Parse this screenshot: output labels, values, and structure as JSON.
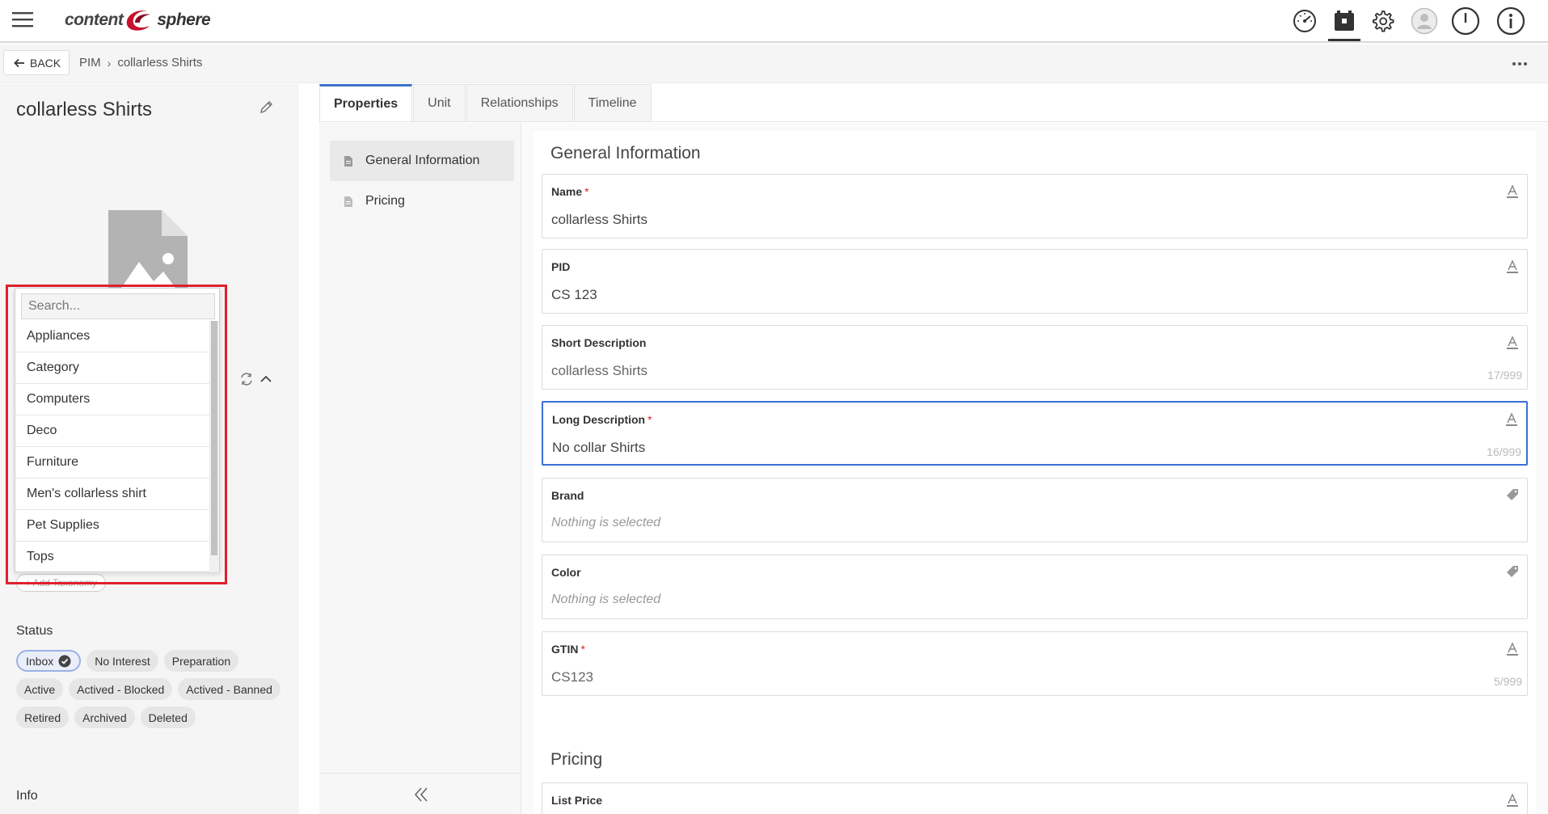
{
  "app": {
    "logo_word1": "content",
    "logo_word2": "sphere"
  },
  "topbar": {
    "icons": [
      "dashboard-gauge-icon",
      "product-catalog-icon",
      "settings-gear-icon",
      "user-avatar-icon",
      "power-icon",
      "info-icon"
    ],
    "active_icon": "product-catalog-icon"
  },
  "breadcrumb": {
    "back_label": "BACK",
    "items": [
      "PIM",
      "collarless Shirts"
    ]
  },
  "entity": {
    "title": "collarless Shirts"
  },
  "taxonomy": {
    "search_placeholder": "Search...",
    "options": [
      "Appliances",
      "Category",
      "Computers",
      "Deco",
      "Furniture",
      "Men's collarless shirt",
      "Pet Supplies",
      "Tops"
    ],
    "add_label": "+ Add Taxonomy"
  },
  "status": {
    "label": "Status",
    "chips": [
      "Inbox",
      "No Interest",
      "Preparation",
      "Active",
      "Actived - Blocked",
      "Actived - Banned",
      "Retired",
      "Archived",
      "Deleted"
    ],
    "selected": "Inbox"
  },
  "info": {
    "label": "Info"
  },
  "tabs": [
    "Properties",
    "Unit",
    "Relationships",
    "Timeline"
  ],
  "active_tab": "Properties",
  "section_nav": [
    "General Information",
    "Pricing"
  ],
  "active_section": "General Information",
  "form": {
    "general_heading": "General Information",
    "fields": [
      {
        "label": "Name",
        "required": true,
        "value": "collarless Shirts",
        "counter": "",
        "icon": "text-field-icon"
      },
      {
        "label": "PID",
        "required": false,
        "value": "CS 123",
        "counter": "",
        "icon": "text-field-icon"
      },
      {
        "label": "Short Description",
        "required": false,
        "value": "collarless Shirts",
        "counter": "17/999",
        "icon": "text-field-icon"
      },
      {
        "label": "Long Description",
        "required": true,
        "value": "No collar Shirts",
        "counter": "16/999",
        "icon": "text-field-icon"
      },
      {
        "label": "Brand",
        "required": false,
        "value": "Nothing is selected",
        "counter": "",
        "icon": "tag-icon"
      },
      {
        "label": "Color",
        "required": false,
        "value": "Nothing is selected",
        "counter": "",
        "icon": "tag-icon"
      },
      {
        "label": "GTIN",
        "required": true,
        "value": "CS123",
        "counter": "5/999",
        "icon": "text-field-icon"
      }
    ],
    "pricing_heading": "Pricing",
    "pricing_field": {
      "label": "List Price",
      "icon": "text-field-icon"
    }
  },
  "colors": {
    "accent": "#3a72c8",
    "required": "#e0202c",
    "highlight": "#e0202c"
  }
}
